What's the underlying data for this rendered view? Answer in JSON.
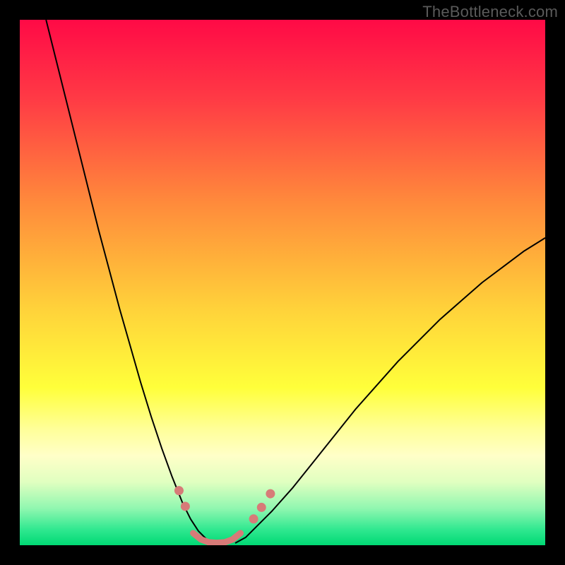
{
  "meta": {
    "watermark": "TheBottleneck.com"
  },
  "chart_data": {
    "type": "line",
    "title": "",
    "xlabel": "",
    "ylabel": "",
    "xlim": [
      0,
      100
    ],
    "ylim": [
      0,
      100
    ],
    "grid": false,
    "legend": false,
    "background": {
      "mode": "vertical-gradient",
      "stops": [
        {
          "pos": 0.0,
          "color": "#ff0a46"
        },
        {
          "pos": 0.15,
          "color": "#ff3a45"
        },
        {
          "pos": 0.35,
          "color": "#ff8b3b"
        },
        {
          "pos": 0.55,
          "color": "#ffd23a"
        },
        {
          "pos": 0.7,
          "color": "#ffff3a"
        },
        {
          "pos": 0.78,
          "color": "#ffff9a"
        },
        {
          "pos": 0.83,
          "color": "#ffffc8"
        },
        {
          "pos": 0.88,
          "color": "#e0ffc0"
        },
        {
          "pos": 0.93,
          "color": "#90f7b0"
        },
        {
          "pos": 0.97,
          "color": "#30e890"
        },
        {
          "pos": 1.0,
          "color": "#00d974"
        }
      ]
    },
    "series": [
      {
        "name": "left-curve",
        "stroke": "#000000",
        "strokeWidth": 2,
        "x": [
          5,
          7,
          9,
          11,
          13,
          15,
          17,
          19,
          21,
          23,
          25,
          27,
          29,
          31,
          32.5,
          34,
          35.5,
          37
        ],
        "y": [
          100,
          92,
          84,
          76,
          68,
          60,
          52.5,
          45,
          38,
          31,
          24.5,
          18.5,
          13,
          8,
          5,
          2.7,
          1.2,
          0.4
        ]
      },
      {
        "name": "right-curve",
        "stroke": "#000000",
        "strokeWidth": 2,
        "x": [
          41,
          43,
          45,
          48,
          52,
          56,
          60,
          64,
          68,
          72,
          76,
          80,
          84,
          88,
          92,
          96,
          100
        ],
        "y": [
          0.4,
          1.5,
          3.5,
          6.5,
          11,
          16,
          21,
          26,
          30.5,
          35,
          39,
          43,
          46.5,
          50,
          53,
          56,
          58.5
        ]
      },
      {
        "name": "valley-floor",
        "stroke": "#d77b78",
        "strokeWidth": 9,
        "linecap": "round",
        "x": [
          33,
          34.5,
          36,
          37.5,
          39,
          40.5,
          42
        ],
        "y": [
          2.3,
          1.1,
          0.55,
          0.45,
          0.55,
          1.1,
          2.3
        ]
      }
    ],
    "markers": [
      {
        "name": "dot-left-1",
        "x": 30.3,
        "y": 10.4,
        "r": 6.5,
        "color": "#d77b78"
      },
      {
        "name": "dot-left-2",
        "x": 31.5,
        "y": 7.4,
        "r": 6.5,
        "color": "#d77b78"
      },
      {
        "name": "dot-right-1",
        "x": 44.5,
        "y": 5.0,
        "r": 6.5,
        "color": "#d77b78"
      },
      {
        "name": "dot-right-2",
        "x": 46.0,
        "y": 7.2,
        "r": 6.5,
        "color": "#d77b78"
      },
      {
        "name": "dot-right-3",
        "x": 47.7,
        "y": 9.8,
        "r": 6.5,
        "color": "#d77b78"
      }
    ]
  }
}
